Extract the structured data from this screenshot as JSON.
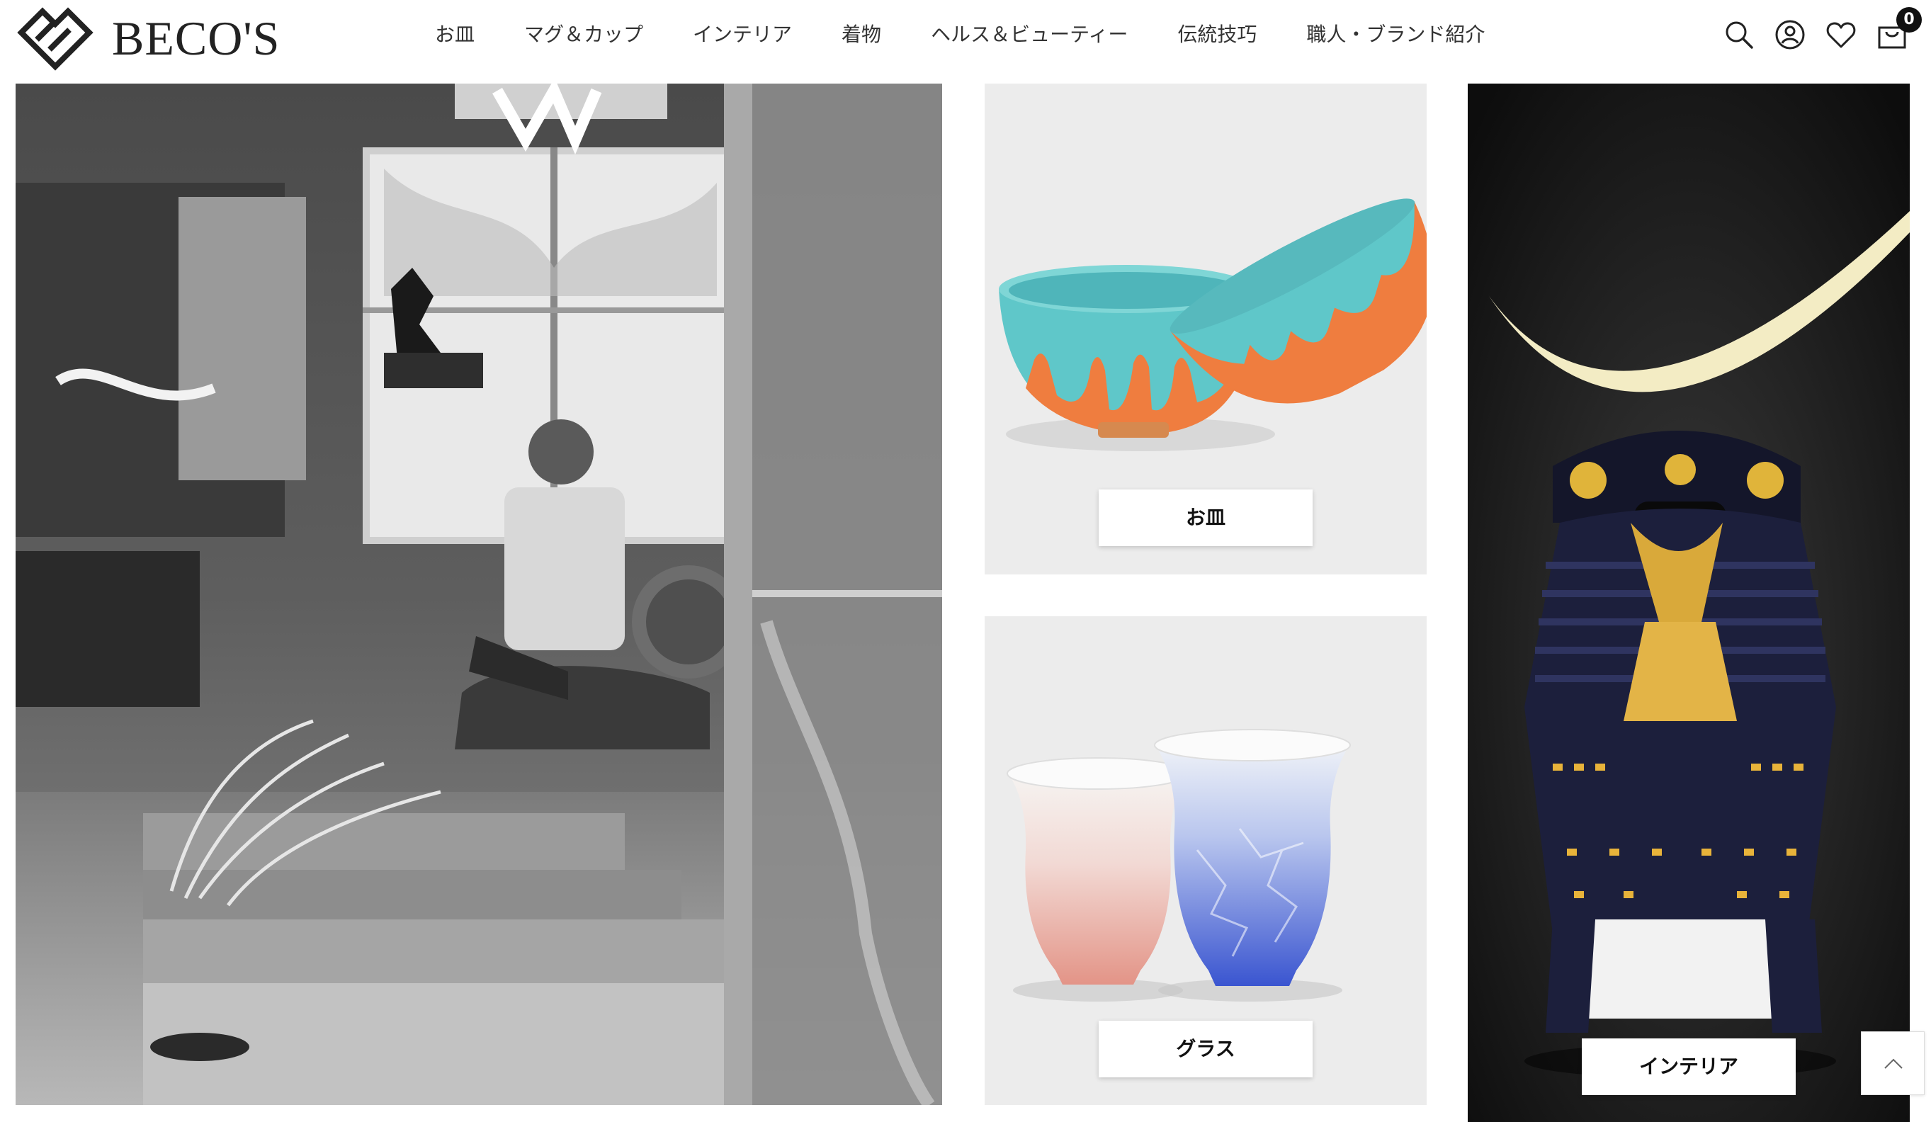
{
  "brand": {
    "name": "BECO'S",
    "logo_icon": "diamond-chevron-logo-icon"
  },
  "nav": {
    "items": [
      {
        "label": "お皿"
      },
      {
        "label": "マグ＆カップ"
      },
      {
        "label": "インテリア"
      },
      {
        "label": "着物"
      },
      {
        "label": "ヘルス＆ビューティー"
      },
      {
        "label": "伝統技巧"
      },
      {
        "label": "職人・ブランド紹介"
      }
    ]
  },
  "header_icons": {
    "search": "search-icon",
    "account": "user-icon",
    "wishlist": "heart-icon",
    "cart": "cart-icon",
    "cart_count": "0"
  },
  "tiles": {
    "workshop": {
      "icon": "craftsman-workshop-photo"
    },
    "plates": {
      "label": "お皿",
      "icon": "turquoise-bowls-photo"
    },
    "glass": {
      "label": "グラス",
      "icon": "crystal-teacups-photo"
    },
    "interior": {
      "label": "インテリア",
      "icon": "samurai-armor-photo"
    }
  },
  "scroll_top": {
    "icon": "chevron-up-icon"
  },
  "colors": {
    "turquoise": "#5fc7c9",
    "orange": "#ef7d3f",
    "cup_pink": "#e8a39a",
    "cup_blue": "#4b67d8",
    "armor_gold": "#e8b33a",
    "armor_navy": "#1c1f3c"
  }
}
